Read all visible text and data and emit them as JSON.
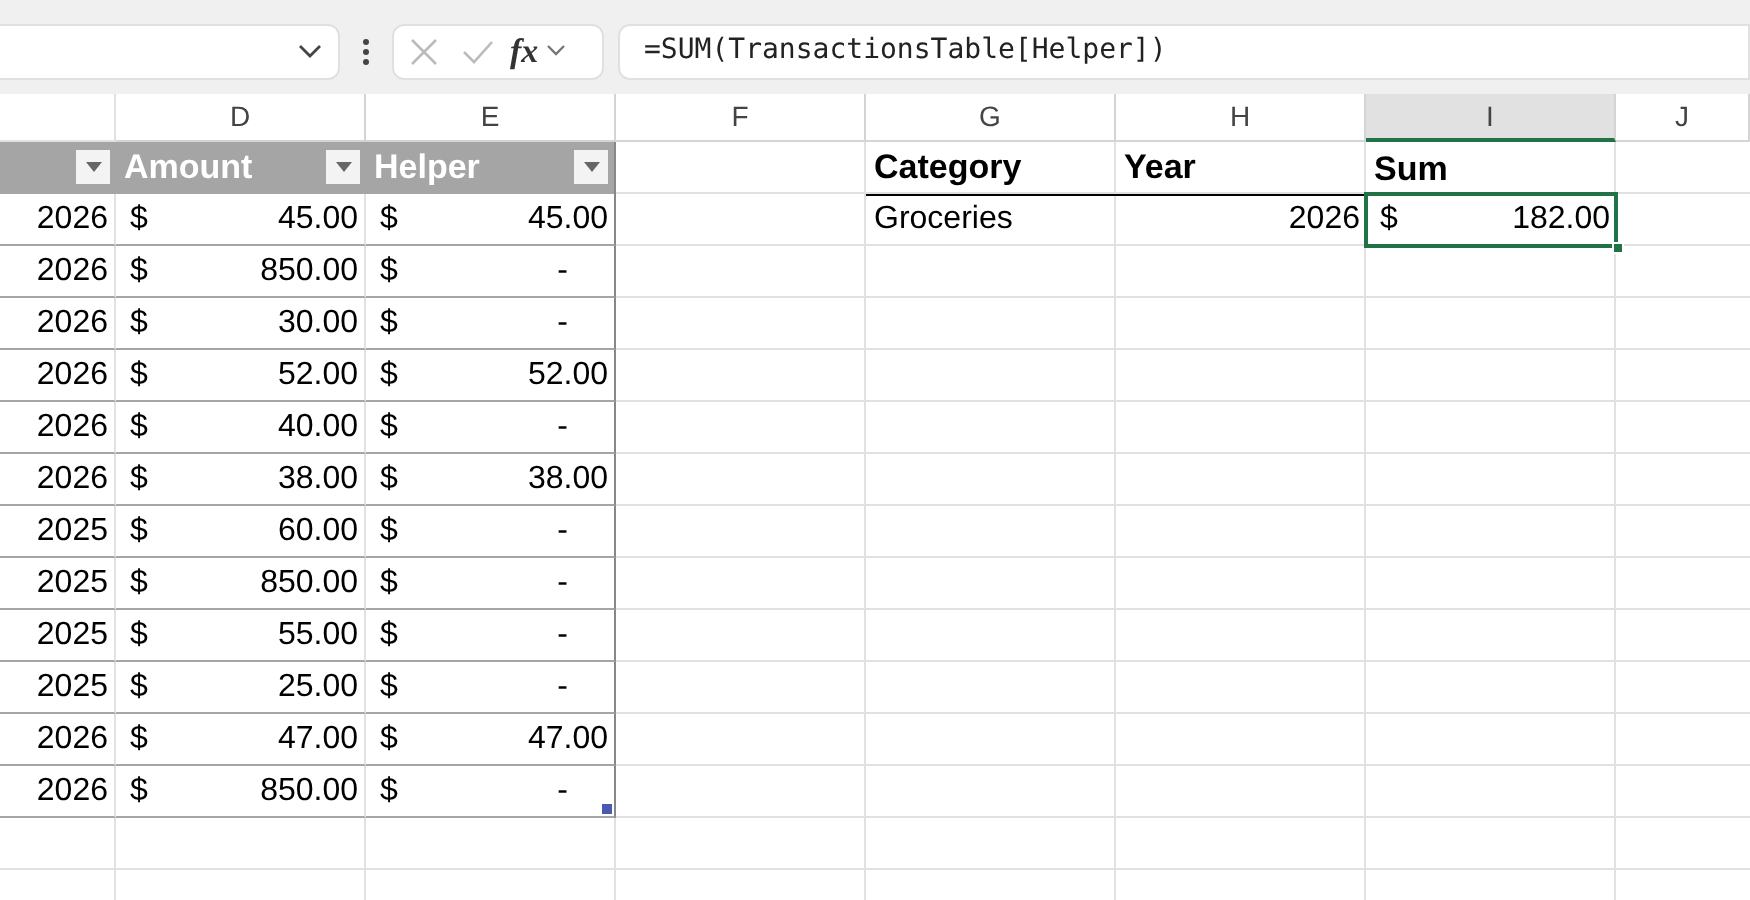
{
  "formula_bar": {
    "function_label": "fx",
    "formula": "=SUM(TransactionsTable[Helper])"
  },
  "column_headers": [
    {
      "label": "D",
      "selected": false
    },
    {
      "label": "E",
      "selected": false
    },
    {
      "label": "F",
      "selected": false
    },
    {
      "label": "G",
      "selected": false
    },
    {
      "label": "H",
      "selected": false
    },
    {
      "label": "I",
      "selected": true
    },
    {
      "label": "J",
      "selected": false
    }
  ],
  "table": {
    "columns": [
      {
        "label": "Amount"
      },
      {
        "label": "Helper"
      }
    ],
    "rows": [
      {
        "column_1": "2026",
        "amount": {
          "symbol": "$",
          "value": "45.00",
          "kind": "number"
        },
        "helper": {
          "symbol": "$",
          "value": "45.00",
          "kind": "number"
        }
      },
      {
        "column_1": "2026",
        "amount": {
          "symbol": "$",
          "value": "850.00",
          "kind": "number"
        },
        "helper": {
          "symbol": "$",
          "value": "-",
          "kind": "dash"
        }
      },
      {
        "column_1": "2026",
        "amount": {
          "symbol": "$",
          "value": "30.00",
          "kind": "number"
        },
        "helper": {
          "symbol": "$",
          "value": "-",
          "kind": "dash"
        }
      },
      {
        "column_1": "2026",
        "amount": {
          "symbol": "$",
          "value": "52.00",
          "kind": "number"
        },
        "helper": {
          "symbol": "$",
          "value": "52.00",
          "kind": "number"
        }
      },
      {
        "column_1": "2026",
        "amount": {
          "symbol": "$",
          "value": "40.00",
          "kind": "number"
        },
        "helper": {
          "symbol": "$",
          "value": "-",
          "kind": "dash"
        }
      },
      {
        "column_1": "2026",
        "amount": {
          "symbol": "$",
          "value": "38.00",
          "kind": "number"
        },
        "helper": {
          "symbol": "$",
          "value": "38.00",
          "kind": "number"
        }
      },
      {
        "column_1": "2025",
        "amount": {
          "symbol": "$",
          "value": "60.00",
          "kind": "number"
        },
        "helper": {
          "symbol": "$",
          "value": "-",
          "kind": "dash"
        }
      },
      {
        "column_1": "2025",
        "amount": {
          "symbol": "$",
          "value": "850.00",
          "kind": "number"
        },
        "helper": {
          "symbol": "$",
          "value": "-",
          "kind": "dash"
        }
      },
      {
        "column_1": "2025",
        "amount": {
          "symbol": "$",
          "value": "55.00",
          "kind": "number"
        },
        "helper": {
          "symbol": "$",
          "value": "-",
          "kind": "dash"
        }
      },
      {
        "column_1": "2025",
        "amount": {
          "symbol": "$",
          "value": "25.00",
          "kind": "number"
        },
        "helper": {
          "symbol": "$",
          "value": "-",
          "kind": "dash"
        }
      },
      {
        "column_1": "2026",
        "amount": {
          "symbol": "$",
          "value": "47.00",
          "kind": "number"
        },
        "helper": {
          "symbol": "$",
          "value": "47.00",
          "kind": "number"
        }
      },
      {
        "column_1": "2026",
        "amount": {
          "symbol": "$",
          "value": "850.00",
          "kind": "number"
        },
        "helper": {
          "symbol": "$",
          "value": "-",
          "kind": "dash"
        }
      }
    ]
  },
  "summary": {
    "headers": [
      {
        "label": "Category"
      },
      {
        "label": "Year"
      },
      {
        "label": "Sum"
      }
    ],
    "rows": [
      {
        "category": "Groceries",
        "year": "2026",
        "sum": {
          "symbol": "$",
          "value": "182.00",
          "kind": "number",
          "selected": true
        }
      }
    ]
  }
}
